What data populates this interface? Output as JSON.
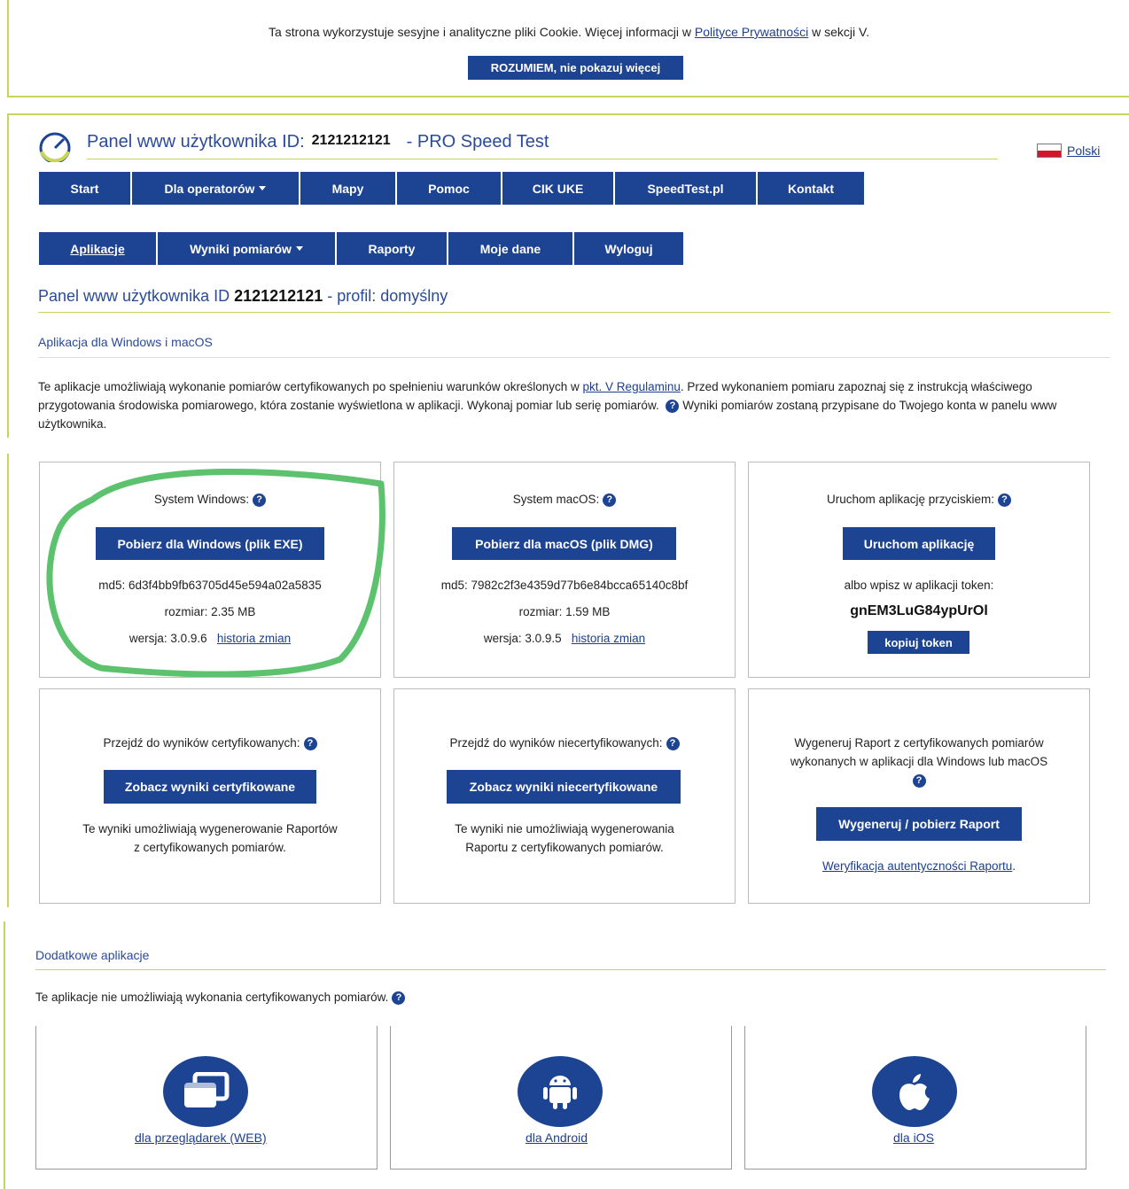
{
  "cookie": {
    "text_before": "Ta strona wykorzystuje sesyjne i analityczne pliki Cookie. Więcej informacji w ",
    "link": "Polityce Prywatności",
    "text_after": " w sekcji V.",
    "button": "ROZUMIEM, nie pokazuj więcej"
  },
  "header": {
    "title": "Panel www użytkownika ID:",
    "user_id": "2121212121",
    "suffix": "- PRO Speed Test",
    "language": "Polski"
  },
  "nav_main": [
    "Start",
    "Dla operatorów",
    "Mapy",
    "Pomoc",
    "CIK UKE",
    "SpeedTest.pl",
    "Kontakt"
  ],
  "nav_user": [
    "Aplikacje",
    "Wyniki pomiarów",
    "Raporty",
    "Moje dane",
    "Wyloguj"
  ],
  "subtitle": {
    "prefix": "Panel www użytkownika ID",
    "user_id": "2121212121",
    "suffix": "- profil: domyślny"
  },
  "section": {
    "heading": "Aplikacja dla Windows i macOS",
    "intro_1": "Te aplikacje umożliwiają wykonanie pomiarów certyfikowanych po spełnieniu warunków określonych w ",
    "intro_link": "pkt. V Regulaminu",
    "intro_2": ". Przed wykonaniem pomiaru zapoznaj się z instrukcją właściwego przygotowania środowiska pomiarowego, która zostanie wyświetlona w aplikacji. Wykonaj pomiar lub serię pomiarów.",
    "intro_3": " Wyniki pomiarów zostaną przypisane do Twojego konta w panelu www użytkownika."
  },
  "windows": {
    "label": "System Windows:",
    "button": "Pobierz dla Windows (plik EXE)",
    "md5": "md5: 6d3f4bb9fb63705d45e594a02a5835",
    "size": "rozmiar: 2.35 MB",
    "version": "wersja: 3.0.9.6",
    "history": "historia zmian"
  },
  "macos": {
    "label": "System macOS:",
    "button": "Pobierz dla macOS (plik DMG)",
    "md5": "md5: 7982c2f3e4359d77b6e84bcca65140c8bf",
    "size": "rozmiar: 1.59 MB",
    "version": "wersja: 3.0.9.5",
    "history": "historia zmian"
  },
  "launch": {
    "label": "Uruchom aplikację przyciskiem:",
    "button": "Uruchom aplikację",
    "or_text": "albo wpisz w aplikacji token:",
    "token": "gnEM3LuG84ypUrOl",
    "copy": "kopiuj token"
  },
  "certified": {
    "label": "Przejdź do wyników certyfikowanych:",
    "button": "Zobacz wyniki certyfikowane",
    "note_1": "Te wyniki umożliwiają wygenerowanie Raportów",
    "note_2": "z certyfikowanych pomiarów."
  },
  "uncertified": {
    "label": "Przejdź do wyników niecertyfikowanych:",
    "button": "Zobacz wyniki niecertyfikowane",
    "note_1": "Te wyniki nie umożliwiają wygenerowania",
    "note_2": "Raportu z certyfikowanych pomiarów."
  },
  "report": {
    "label_1": "Wygeneruj Raport z certyfikowanych pomiarów",
    "label_2": "wykonanych w aplikacji dla Windows lub macOS",
    "button": "Wygeneruj / pobierz Raport",
    "verify": "Weryfikacja autentyczności Raportu",
    "verify_dot": "."
  },
  "extra": {
    "heading": "Dodatkowe aplikacje",
    "note": "Te aplikacje nie umożliwiają wykonania certyfikowanych pomiarów.",
    "web": "dla przeglądarek (WEB)",
    "android": "dla Android",
    "ios": "dla iOS"
  },
  "colors": {
    "brand": "#1d4393",
    "accent": "#c9d45a",
    "highlight_oval": "#5cc26e"
  },
  "icons": [
    "speedometer-icon",
    "poland-flag-icon",
    "help-icon",
    "browser-windows-icon",
    "android-icon",
    "apple-icon",
    "caret-down-icon"
  ]
}
